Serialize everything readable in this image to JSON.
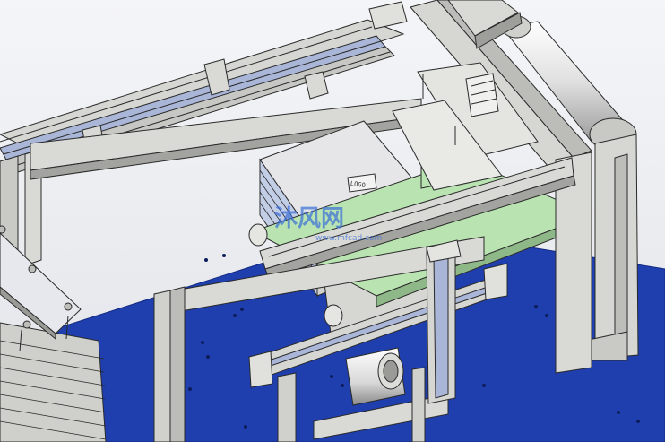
{
  "watermark": {
    "main_text": "沐风网",
    "sub_text": "www.mfcad.com"
  },
  "part_label": {
    "text": "LOGO"
  },
  "colors": {
    "background_top": "#f2f3f6",
    "background_bottom": "#e4e6ea",
    "base_plate": "#1f3fae",
    "base_plate_edge": "#16308a",
    "frame_light": "#d9d9d6",
    "frame_mid": "#c4c4c0",
    "frame_dark": "#8f8f8b",
    "rail_blue": "#a9b6d8",
    "conveyor_belt": "#b8e2b0",
    "roller": "#e6e6e6",
    "edge": "#2a2a2a",
    "watermark": "#3a6fd8"
  }
}
